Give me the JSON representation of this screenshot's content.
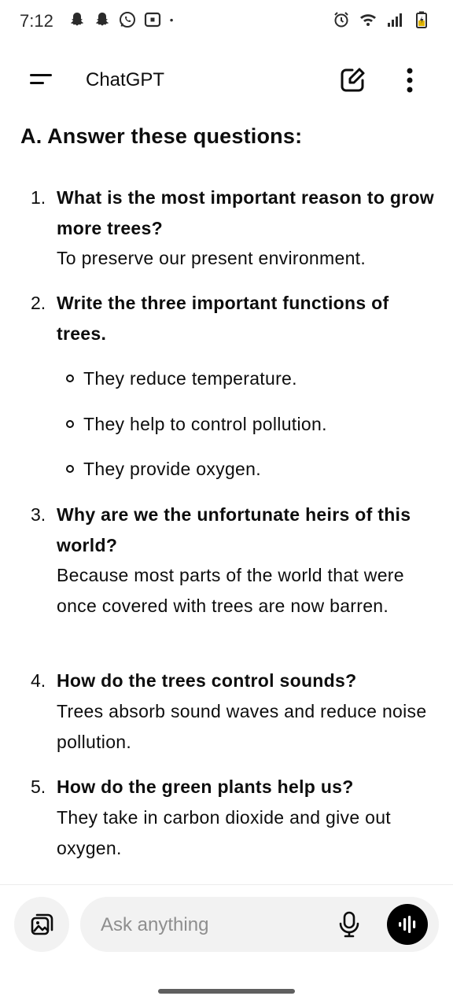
{
  "status_bar": {
    "time": "7:12",
    "left_icons": [
      "snapchat-icon",
      "snapchat-icon",
      "whatsapp-icon",
      "app-notification-icon",
      "more-notifications-dot"
    ],
    "right_icons": [
      "alarm-icon",
      "wifi-icon",
      "signal-icon",
      "battery-charging-icon"
    ]
  },
  "header": {
    "title": "ChatGPT",
    "menu_icon": "menu-icon",
    "edit_icon": "new-chat-icon",
    "more_icon": "more-vertical-icon"
  },
  "content": {
    "heading": "A. Answer these questions:",
    "items": [
      {
        "number": "1.",
        "question": "What is the most important reason to grow more trees?",
        "answer": "To preserve our present environment."
      },
      {
        "number": "2.",
        "question": "Write the three important functions of trees.",
        "bullets": [
          "They reduce temperature.",
          "They help to control pollution.",
          "They provide oxygen."
        ]
      },
      {
        "number": "3.",
        "question": "Why are we the unfortunate heirs of this world?",
        "answer": "Because most parts of the world that were once covered with trees are now barren."
      },
      {
        "number": "4.",
        "question": "How do the trees control sounds?",
        "answer": "Trees absorb sound waves and reduce noise pollution."
      },
      {
        "number": "5.",
        "question": "How do the green plants help us?",
        "answer": "They take in carbon dioxide and give out oxygen."
      }
    ]
  },
  "composer": {
    "placeholder": "Ask anything",
    "value": "",
    "attach_icon": "image-attach-icon",
    "mic_icon": "microphone-icon",
    "voice_icon": "voice-mode-icon"
  },
  "colors": {
    "text": "#0d0d0d",
    "placeholder": "#8e8e8e",
    "composer_bg": "#f2f2f2",
    "voice_button_bg": "#000000",
    "background": "#ffffff"
  }
}
